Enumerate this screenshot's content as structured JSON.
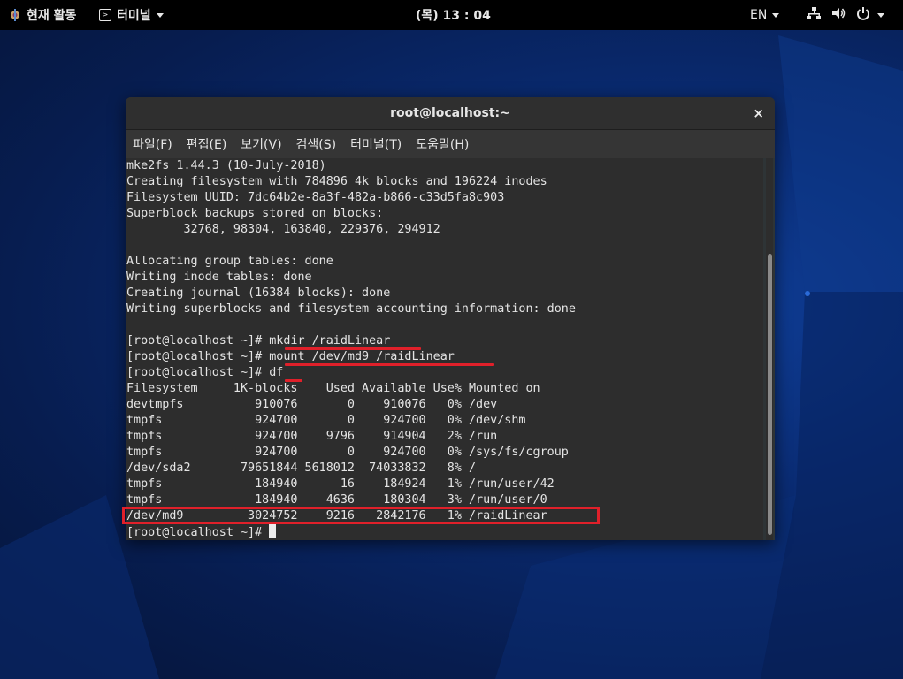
{
  "topbar": {
    "activities_label": "현재 활동",
    "app_menu_label": "터미널",
    "clock": "(목) 13 : 04",
    "input_method": "EN"
  },
  "window": {
    "title": "root@localhost:~",
    "close_label": "×",
    "menu": [
      "파일(F)",
      "편집(E)",
      "보기(V)",
      "검색(S)",
      "터미널(T)",
      "도움말(H)"
    ]
  },
  "terminal": {
    "lines": [
      "mke2fs 1.44.3 (10-July-2018)",
      "Creating filesystem with 784896 4k blocks and 196224 inodes",
      "Filesystem UUID: 7dc64b2e-8a3f-482a-b866-c33d5fa8c903",
      "Superblock backups stored on blocks:",
      "        32768, 98304, 163840, 229376, 294912",
      "",
      "Allocating group tables: done",
      "Writing inode tables: done",
      "Creating journal (16384 blocks): done",
      "Writing superblocks and filesystem accounting information: done",
      "",
      "[root@localhost ~]# mkdir /raidLinear",
      "[root@localhost ~]# mount /dev/md9 /raidLinear",
      "[root@localhost ~]# df",
      "Filesystem     1K-blocks    Used Available Use% Mounted on",
      "devtmpfs          910076       0    910076   0% /dev",
      "tmpfs             924700       0    924700   0% /dev/shm",
      "tmpfs             924700    9796    914904   2% /run",
      "tmpfs             924700       0    924700   0% /sys/fs/cgroup",
      "/dev/sda2       79651844 5618012  74033832   8% /",
      "tmpfs             184940      16    184924   1% /run/user/42",
      "tmpfs             184940    4636    180304   3% /run/user/0",
      "/dev/md9         3024752    9216   2842176   1% /raidLinear"
    ],
    "prompt": "[root@localhost ~]# "
  },
  "colors": {
    "highlight": "#e0202a",
    "terminal_bg": "#2d2d2d",
    "terminal_fg": "#e4e4e4"
  }
}
